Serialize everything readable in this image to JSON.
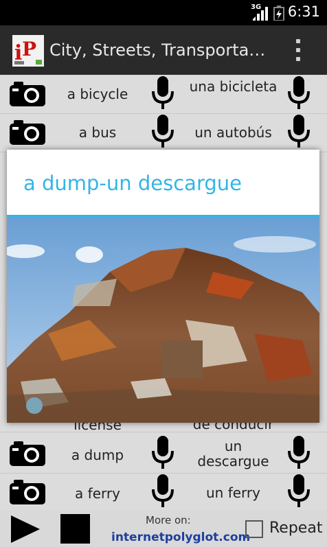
{
  "status": {
    "network": "3G",
    "time": "6:31"
  },
  "app": {
    "title": "City, Streets, Transporta…",
    "logo_text": "iP"
  },
  "rows": [
    {
      "en": "a bicycle",
      "es": "una bicicleta"
    },
    {
      "en": "a bus",
      "es": "un autobús"
    },
    {
      "en": "license",
      "es": "de conducir"
    },
    {
      "en": "a dump",
      "es": "un descargue"
    },
    {
      "en": "a ferry",
      "es": "un ferry"
    }
  ],
  "dialog": {
    "title": "a dump-un descargue",
    "image": "scrap-metal-dump-photo"
  },
  "bottom": {
    "more_on": "More on:",
    "link": "internetpolyglot.com",
    "repeat": "Repeat"
  },
  "colors": {
    "accent": "#33b5e5",
    "link": "#1f3f9e"
  }
}
